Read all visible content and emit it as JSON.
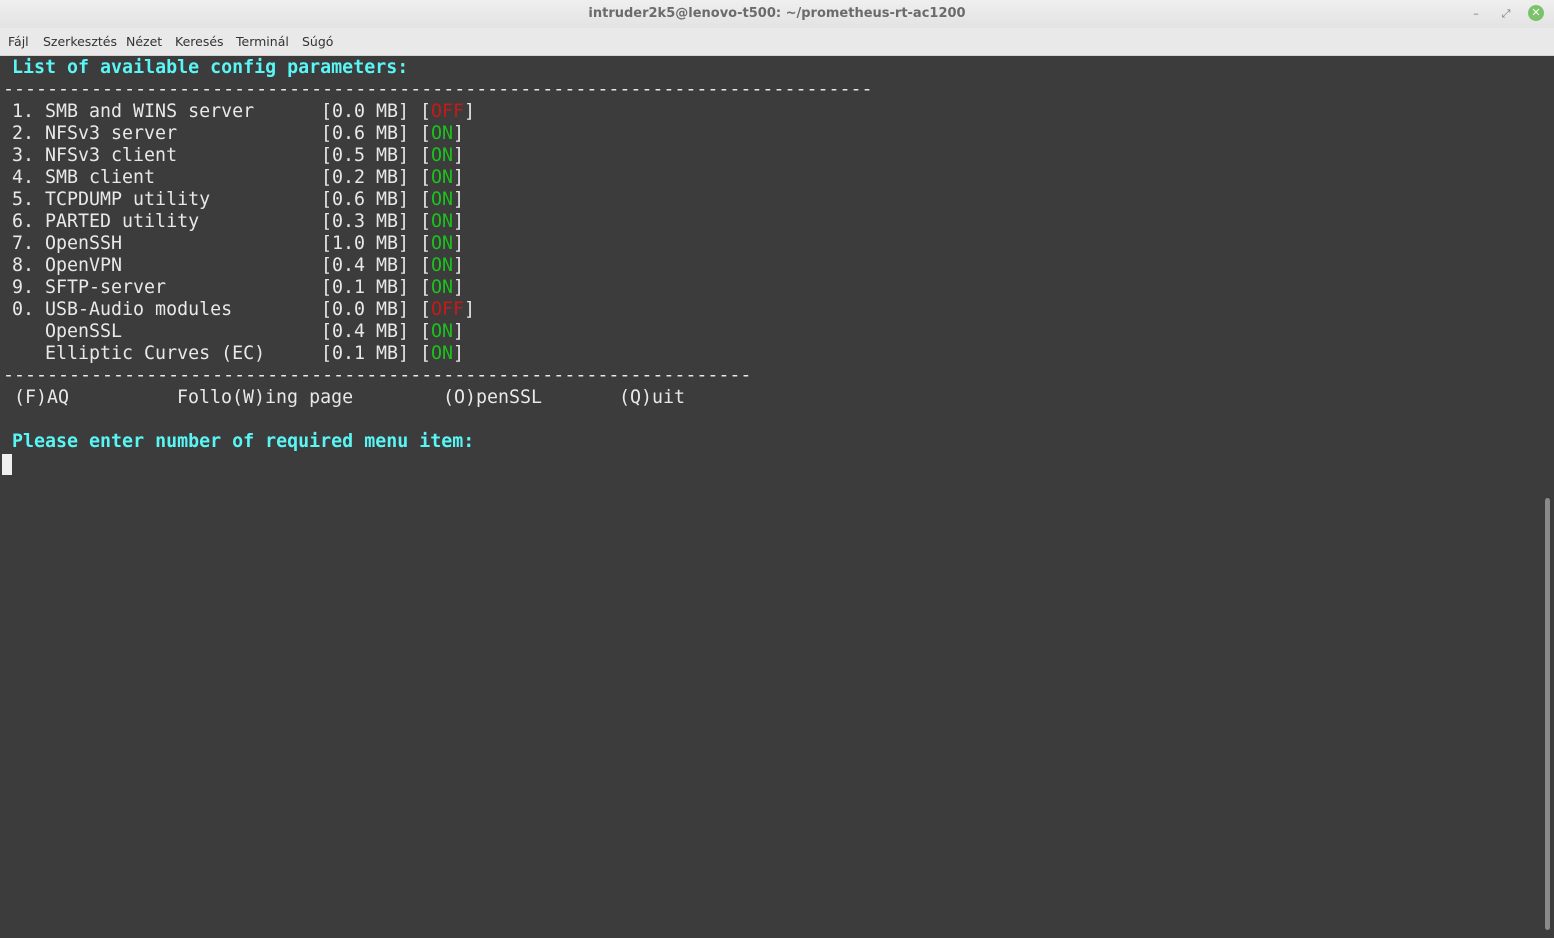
{
  "window": {
    "title": "intruder2k5@lenovo-t500: ~/prometheus-rt-ac1200",
    "buttons": {
      "minimize": "–",
      "maximize": "⤢",
      "close": "✕"
    }
  },
  "menu": [
    "Fájl",
    "Szerkesztés",
    "Nézet",
    "Keresés",
    "Terminál",
    "Súgó"
  ],
  "terminal": {
    "heading": "List of available config parameters:",
    "separator_top": "-------------------------------------------------------------------------------",
    "items": [
      {
        "num": "1.",
        "name": "SMB and WINS server",
        "size": "[0.0 MB]",
        "status": "OFF"
      },
      {
        "num": "2.",
        "name": "NFSv3 server",
        "size": "[0.6 MB]",
        "status": "ON"
      },
      {
        "num": "3.",
        "name": "NFSv3 client",
        "size": "[0.5 MB]",
        "status": "ON"
      },
      {
        "num": "4.",
        "name": "SMB client",
        "size": "[0.2 MB]",
        "status": "ON"
      },
      {
        "num": "5.",
        "name": "TCPDUMP utility",
        "size": "[0.6 MB]",
        "status": "ON"
      },
      {
        "num": "6.",
        "name": "PARTED utility",
        "size": "[0.3 MB]",
        "status": "ON"
      },
      {
        "num": "7.",
        "name": "OpenSSH",
        "size": "[1.0 MB]",
        "status": "ON"
      },
      {
        "num": "8.",
        "name": "OpenVPN",
        "size": "[0.4 MB]",
        "status": "ON"
      },
      {
        "num": "9.",
        "name": "SFTP-server",
        "size": "[0.1 MB]",
        "status": "ON"
      },
      {
        "num": "0.",
        "name": "USB-Audio modules",
        "size": "[0.0 MB]",
        "status": "OFF"
      },
      {
        "num": "",
        "name": "OpenSSL",
        "size": "[0.4 MB]",
        "status": "ON"
      },
      {
        "num": "",
        "name": "Elliptic Curves (EC)",
        "size": "[0.1 MB]",
        "status": "ON"
      }
    ],
    "separator_bottom": "--------------------------------------------------------------------",
    "options": {
      "faq": "(F)AQ",
      "following": "Follo(W)ing page",
      "openssl": "(O)penSSL",
      "quit": "(Q)uit"
    },
    "prompt": "Please enter number of required menu item:"
  },
  "colors": {
    "on": "#1cc21c",
    "off": "#c41a1a",
    "heading": "#5af5f5",
    "background": "#3c3c3c"
  }
}
